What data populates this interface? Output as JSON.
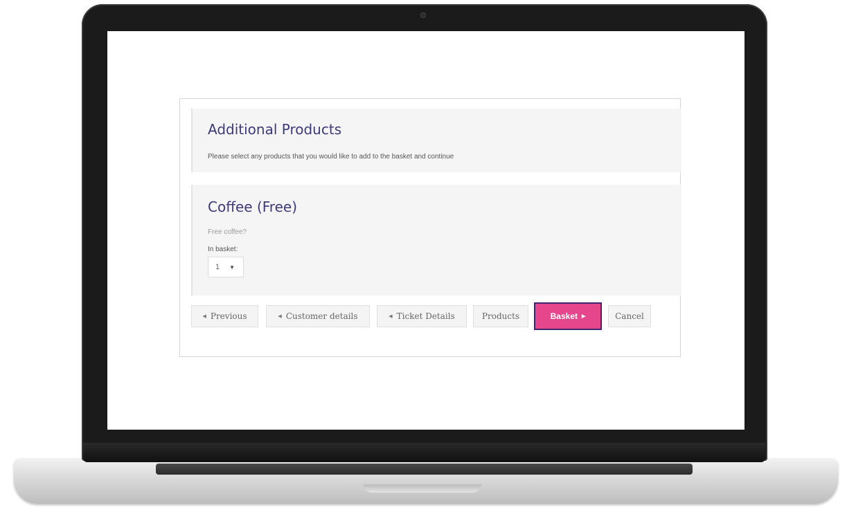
{
  "intro": {
    "title": "Additional Products",
    "instruction": "Please select any products that you would like to add to the basket and continue"
  },
  "product": {
    "title": "Coffee (Free)",
    "description": "Free coffee?",
    "basket_label": "In basket:",
    "quantity": "1"
  },
  "nav": {
    "previous": "Previous",
    "customer_details": "Customer details",
    "ticket_details": "Ticket Details",
    "products": "Products",
    "basket": "Basket",
    "cancel": "Cancel"
  },
  "icons": {
    "back_arrow": "chevron-left-icon",
    "forward_arrow": "chevron-right-icon",
    "dropdown": "chevron-down-icon"
  },
  "colors": {
    "title": "#3d3a78",
    "primary_button": "#e6478c",
    "primary_button_border": "#3e2670"
  }
}
